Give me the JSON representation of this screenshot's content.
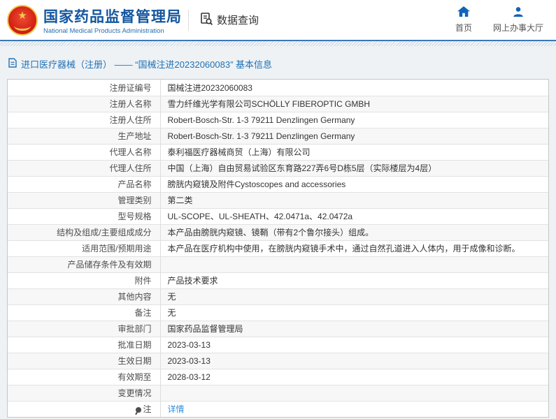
{
  "colors": {
    "title-blue": "#14569f",
    "subtitle-blue": "#2a6db5",
    "nav-icon-blue": "#1063b8",
    "rule-blue": "#3a78b5",
    "breadcrumb-blue": "#2271b3",
    "link-blue": "#2e8de0",
    "emblem-red": "#cf1b10",
    "emblem-gold": "#f2c94c",
    "content-bg": "#eef2f5",
    "row-alt-bg": "#f7f7f7"
  },
  "header": {
    "title": "国家药品监督管理局",
    "subtitle": "National Medical Products Administration",
    "data_query": {
      "label": "数据查询",
      "icon": "doc-search-icon"
    },
    "nav": [
      {
        "label": "首页",
        "icon": "home-icon"
      },
      {
        "label": "网上办事大厅",
        "icon": "user-icon"
      }
    ]
  },
  "breadcrumb": {
    "icon": "document-icon",
    "text": "进口医疗器械（注册） —— “国械注进20232060083” 基本信息"
  },
  "table": {
    "rows": [
      {
        "label": "注册证编号",
        "value": "国械注进20232060083"
      },
      {
        "label": "注册人名称",
        "value": "雪力纤维光学有限公司SCHÖLLY FIBEROPTIC GMBH"
      },
      {
        "label": "注册人住所",
        "value": "Robert-Bosch-Str. 1-3 79211 Denzlingen Germany"
      },
      {
        "label": "生产地址",
        "value": "Robert-Bosch-Str. 1-3 79211 Denzlingen Germany"
      },
      {
        "label": "代理人名称",
        "value": "泰利福医疗器械商贸（上海）有限公司"
      },
      {
        "label": "代理人住所",
        "value": "中国（上海）自由贸易试验区东育路227弄6号D栋5层（实际楼层为4层）"
      },
      {
        "label": "产品名称",
        "value": "膀胱内窥镜及附件Cystoscopes and accessories"
      },
      {
        "label": "管理类别",
        "value": "第二类"
      },
      {
        "label": "型号规格",
        "value": "UL-SCOPE、UL-SHEATH、42.0471a、42.0472a"
      },
      {
        "label": "结构及组成/主要组成成分",
        "value": "本产品由膀胱内窥镜、镜鞘（带有2个鲁尔接头）组成。"
      },
      {
        "label": "适用范围/预期用途",
        "value": "本产品在医疗机构中使用，在膀胱内窥镜手术中，通过自然孔道进入人体内，用于成像和诊断。"
      },
      {
        "label": "产品储存条件及有效期",
        "value": ""
      },
      {
        "label": "附件",
        "value": "产品技术要求"
      },
      {
        "label": "其他内容",
        "value": "无"
      },
      {
        "label": "备注",
        "value": "无"
      },
      {
        "label": "审批部门",
        "value": "国家药品监督管理局"
      },
      {
        "label": "批准日期",
        "value": "2023-03-13"
      },
      {
        "label": "生效日期",
        "value": "2023-03-13"
      },
      {
        "label": "有效期至",
        "value": "2028-03-12"
      },
      {
        "label": "变更情况",
        "value": ""
      },
      {
        "label": "注",
        "label_icon": "note-pin-icon",
        "value": "详情",
        "link": true
      }
    ]
  }
}
